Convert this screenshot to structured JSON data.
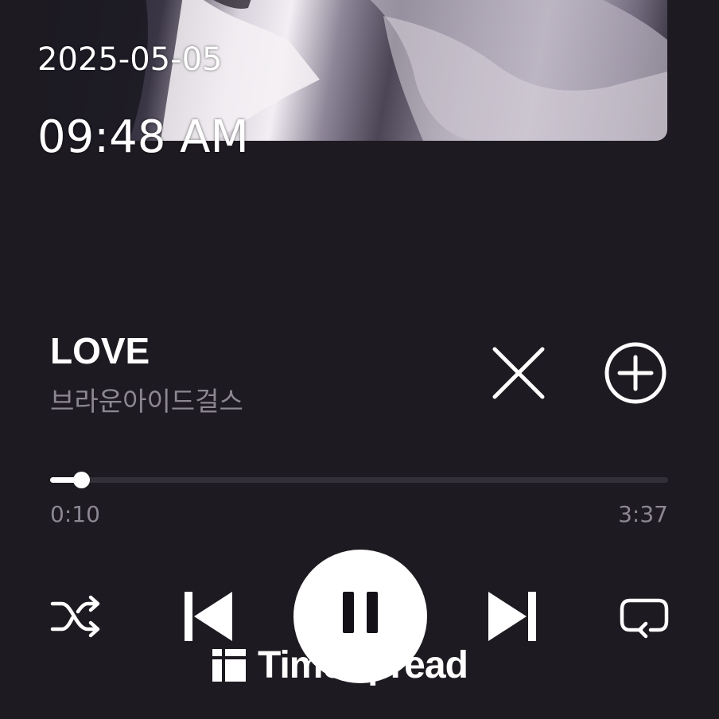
{
  "overlay": {
    "date": "2025-05-05",
    "time": "09:48 AM"
  },
  "track": {
    "title": "LOVE",
    "artist": "브라운아이드걸스"
  },
  "progress": {
    "elapsed": "0:10",
    "total": "3:37",
    "fraction": 0.05
  },
  "icons": {
    "close": "close-icon",
    "add": "plus-circle-icon",
    "shuffle": "shuffle-icon",
    "previous": "skip-previous-icon",
    "pause": "pause-icon",
    "next": "skip-next-icon",
    "repeat": "repeat-icon",
    "watermark_logo": "timespread-logo-icon"
  },
  "watermark": {
    "text": "TimeSpread"
  },
  "colors": {
    "background": "#1e1a21",
    "primary_text": "#ffffff",
    "secondary_text": "#8c8791",
    "progress_track": "#34303a"
  }
}
